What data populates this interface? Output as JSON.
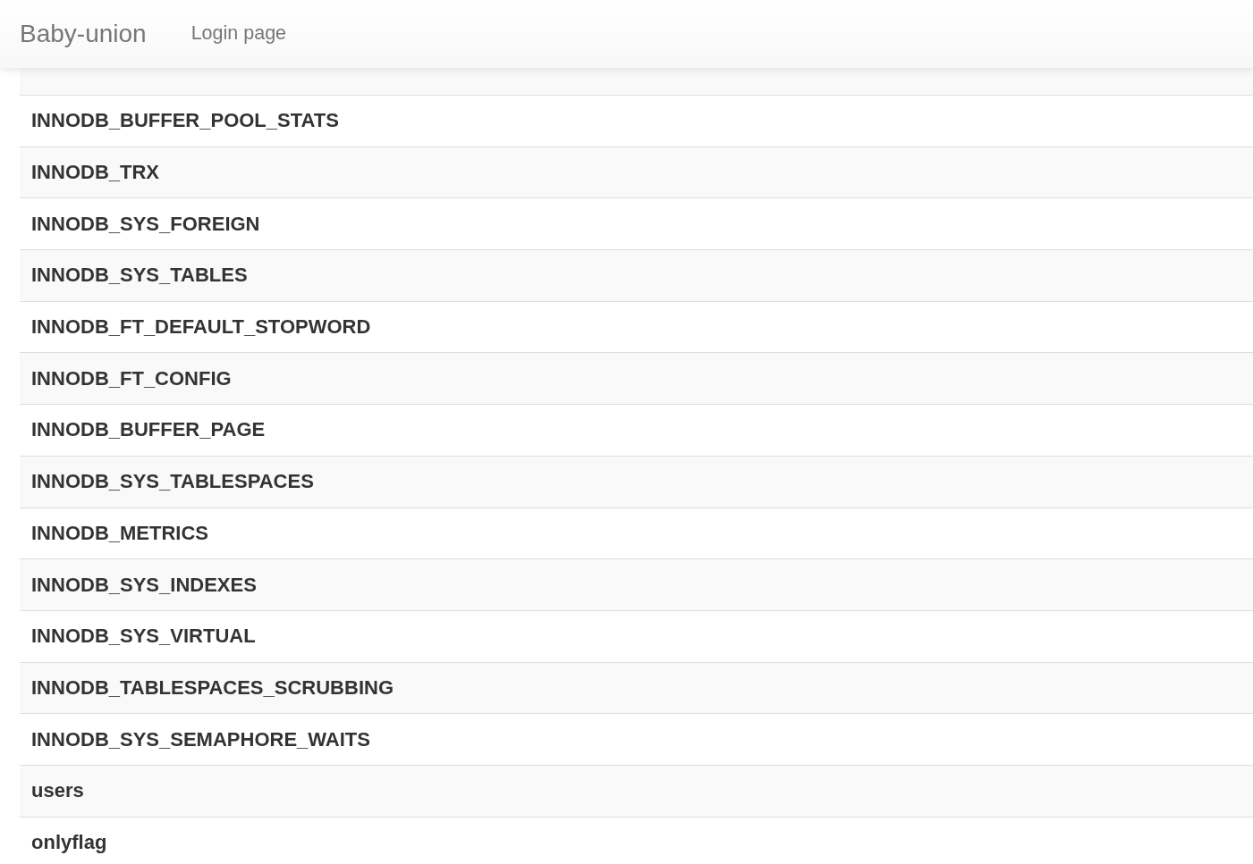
{
  "navbar": {
    "brand": "Baby-union",
    "links": [
      {
        "label": "Login page"
      }
    ]
  },
  "table": {
    "rows": [
      {
        "name": "INNODB_BUFFER_POOL_STATS"
      },
      {
        "name": "INNODB_TRX"
      },
      {
        "name": "INNODB_SYS_FOREIGN"
      },
      {
        "name": "INNODB_SYS_TABLES"
      },
      {
        "name": "INNODB_FT_DEFAULT_STOPWORD"
      },
      {
        "name": "INNODB_FT_CONFIG"
      },
      {
        "name": "INNODB_BUFFER_PAGE"
      },
      {
        "name": "INNODB_SYS_TABLESPACES"
      },
      {
        "name": "INNODB_METRICS"
      },
      {
        "name": "INNODB_SYS_INDEXES"
      },
      {
        "name": "INNODB_SYS_VIRTUAL"
      },
      {
        "name": "INNODB_TABLESPACES_SCRUBBING"
      },
      {
        "name": "INNODB_SYS_SEMAPHORE_WAITS"
      },
      {
        "name": "users"
      },
      {
        "name": "onlyflag"
      }
    ]
  }
}
